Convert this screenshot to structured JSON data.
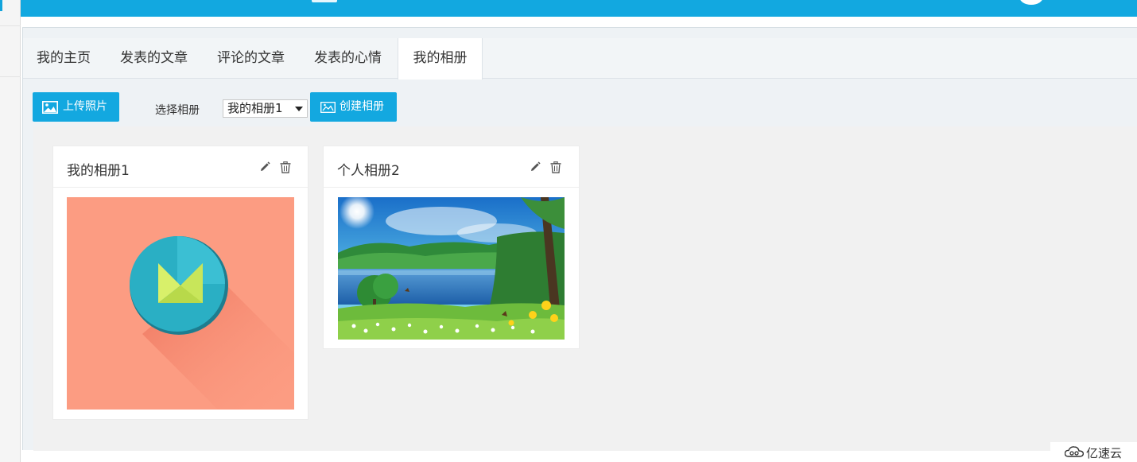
{
  "tabs": [
    "我的主页",
    "发表的文章",
    "评论的文章",
    "发表的心情",
    "我的相册"
  ],
  "active_tab": "我的相册",
  "toolbar": {
    "upload_label": "上传照片",
    "select_label": "选择相册",
    "selected_album": "我的相册1",
    "create_label": "创建相册"
  },
  "albums": [
    {
      "title": "我的相册1",
      "cover": "material-design-logo-on-salmon-background"
    },
    {
      "title": "个人相册2",
      "cover": "lake-landscape-with-trees-and-flowers"
    }
  ],
  "watermark": "亿速云",
  "colors": {
    "accent": "#13a8e0",
    "cover1_bg": "#fc9c82"
  },
  "icons": [
    "image-icon",
    "gallery-icon",
    "pencil-icon",
    "trash-icon",
    "dropdown-arrow-icon"
  ]
}
